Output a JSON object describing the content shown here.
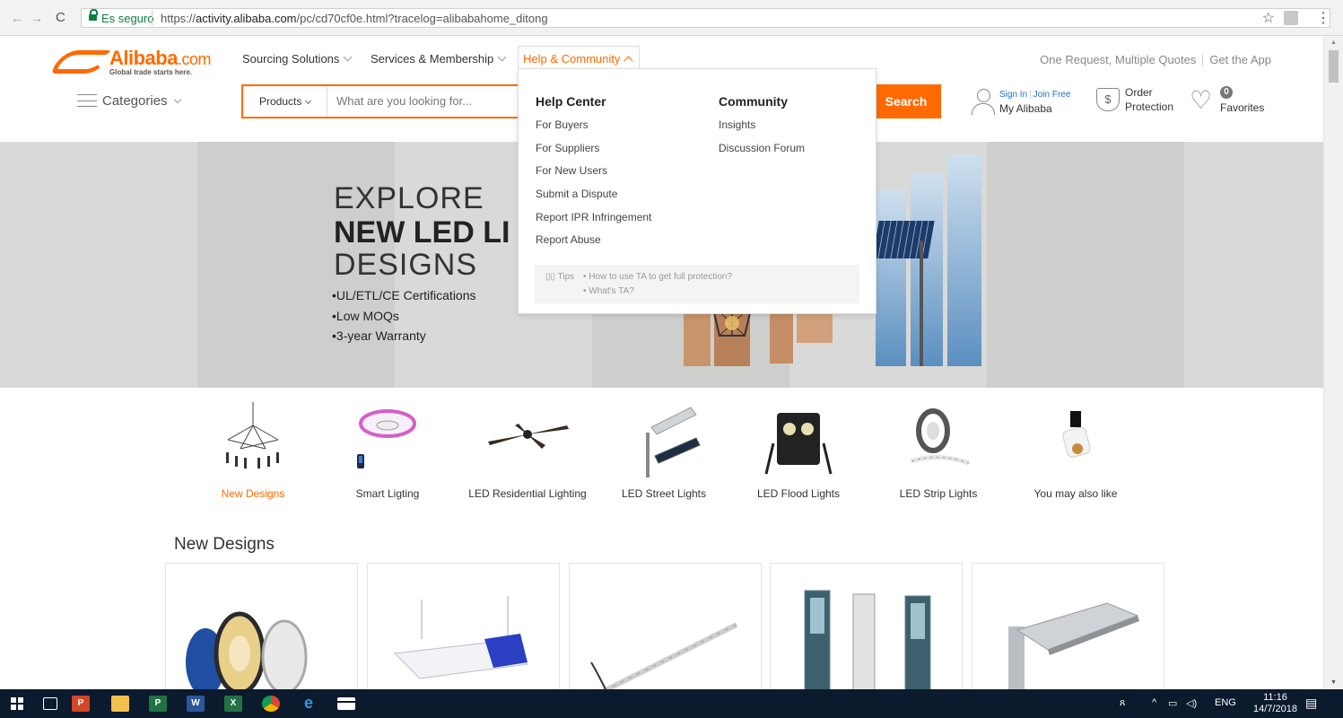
{
  "browser": {
    "secure_label": "Es seguro",
    "url_prefix": "https://",
    "url_domain": "activity.alibaba.com",
    "url_path": "/pc/cd70cf0e.html?tracelog=alibabahome_ditong"
  },
  "header": {
    "logo_text": "Alibaba",
    "logo_suffix": ".com",
    "logo_tagline": "Global trade starts here.",
    "nav": {
      "sourcing": "Sourcing Solutions",
      "services": "Services & Membership",
      "help": "Help & Community"
    },
    "top_links": {
      "rfq": "One Request, Multiple Quotes",
      "app": "Get the App"
    },
    "categories_label": "Categories",
    "search": {
      "category": "Products",
      "placeholder": "What are you looking for...",
      "button": "Search"
    },
    "account": {
      "sign_in": "Sign In",
      "join": "Join Free",
      "my_alibaba": "My Alibaba"
    },
    "order": {
      "line1": "Order",
      "line2": "Protection"
    },
    "favorites": {
      "count": "0",
      "label": "Favorites"
    }
  },
  "dropdown": {
    "help_title": "Help Center",
    "help_links": [
      "For Buyers",
      "For Suppliers",
      "For New Users",
      "Submit a Dispute",
      "Report IPR Infringement",
      "Report Abuse"
    ],
    "community_title": "Community",
    "community_links": [
      "Insights",
      "Discussion Forum"
    ],
    "tips_label": "Tips",
    "tips": [
      "• How to use TA to get full protection?",
      "• What's TA?"
    ]
  },
  "banner": {
    "line1": "EXPLORE",
    "line2": "NEW LED LI",
    "line3": "DESIGNS",
    "bullets": [
      "•UL/ETL/CE Certifications",
      "•Low MOQs",
      "•3-year Warranty"
    ]
  },
  "categories": [
    {
      "label": "New Designs",
      "active": true
    },
    {
      "label": "Smart Ligting",
      "active": false
    },
    {
      "label": "LED Residential Lighting",
      "active": false
    },
    {
      "label": "LED Street Lights",
      "active": false
    },
    {
      "label": "LED Flood Lights",
      "active": false
    },
    {
      "label": "LED Strip Lights",
      "active": false
    },
    {
      "label": "You may also like",
      "active": false
    }
  ],
  "section_title": "New Designs",
  "taskbar": {
    "lang": "ENG",
    "time": "11:16",
    "date": "14/7/2018"
  },
  "colors": {
    "accent": "#ff6a00",
    "link": "#1a6fd1",
    "secure": "#0b8043"
  }
}
